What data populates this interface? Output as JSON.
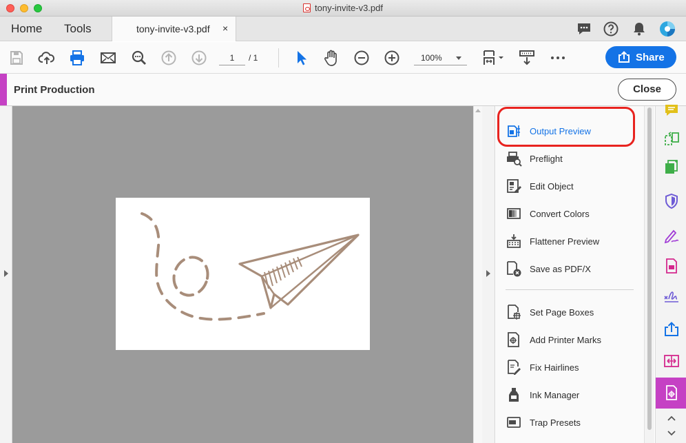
{
  "window": {
    "title": "tony-invite-v3.pdf"
  },
  "tabs": {
    "home": "Home",
    "tools": "Tools",
    "document": "tony-invite-v3.pdf",
    "close_symbol": "×"
  },
  "toolbar": {
    "page_current": "1",
    "page_total": "/ 1",
    "zoom": "100%",
    "share_label": "Share",
    "icons": [
      "save-icon",
      "cloud-upload-icon",
      "print-icon",
      "email-icon",
      "search-zoom-icon",
      "page-up-icon",
      "page-down-icon",
      "select-arrow-icon",
      "hand-icon",
      "zoom-out-icon",
      "zoom-in-icon",
      "page-fit-icon",
      "scroll-icon",
      "more-icon"
    ]
  },
  "header_icons": [
    "comment-icon",
    "help-icon",
    "bell-icon",
    "avatar"
  ],
  "production": {
    "title": "Print Production",
    "close_label": "Close"
  },
  "panel": {
    "items": [
      {
        "label": "Output Preview",
        "icon": "output-preview-icon",
        "active": true
      },
      {
        "label": "Preflight",
        "icon": "preflight-icon"
      },
      {
        "label": "Edit Object",
        "icon": "edit-object-icon"
      },
      {
        "label": "Convert Colors",
        "icon": "convert-colors-icon"
      },
      {
        "label": "Flattener Preview",
        "icon": "flattener-preview-icon"
      },
      {
        "label": "Save as PDF/X",
        "icon": "save-pdfx-icon"
      },
      {
        "label": "Set Page Boxes",
        "icon": "set-page-boxes-icon"
      },
      {
        "label": "Add Printer Marks",
        "icon": "printer-marks-icon"
      },
      {
        "label": "Fix Hairlines",
        "icon": "fix-hairlines-icon"
      },
      {
        "label": "Ink Manager",
        "icon": "ink-manager-icon"
      },
      {
        "label": "Trap Presets",
        "icon": "trap-presets-icon"
      }
    ]
  },
  "rail": {
    "items": [
      "comment-tool-icon",
      "organize-pages-icon",
      "combine-files-icon",
      "protect-shield-icon",
      "fill-sign-icon",
      "export-pdf-icon",
      "signature-icon",
      "share-export-icon",
      "compare-files-icon",
      "print-production-icon"
    ]
  },
  "colors": {
    "accent_blue": "#1473e6",
    "production_purple": "#c541c4",
    "highlight_red": "#e8231f",
    "doodle_brown": "#a88d7a"
  }
}
